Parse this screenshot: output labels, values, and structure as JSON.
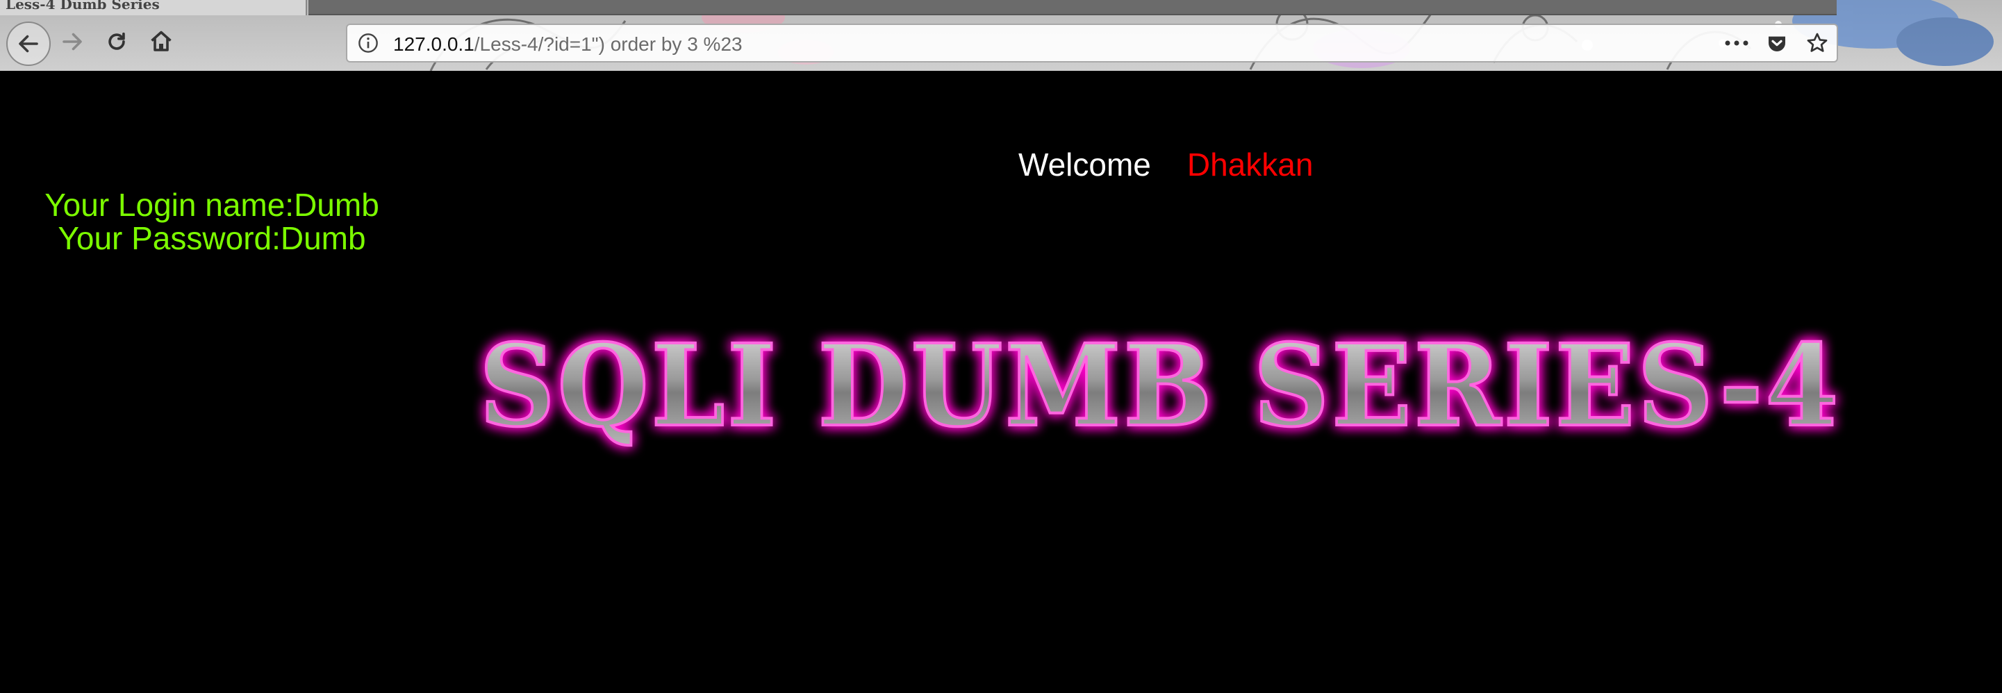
{
  "browser": {
    "tab_title": "Less-4 Dumb Series",
    "url_host": "127.0.0.1",
    "url_path": "/Less-4/?id=1\") order by 3 %23"
  },
  "page": {
    "welcome_label": "Welcome",
    "welcome_name": "Dhakkan",
    "login_line": "Your Login name:Dumb",
    "password_line": "Your Password:Dumb",
    "banner_text": "SQLI DUMB SERIES-4"
  },
  "colors": {
    "welcome": "#ffffff",
    "name": "#ff0000",
    "info": "#7cfc00",
    "banner_glow": "#ff00cc",
    "banner_fill": "#9a9a9a"
  }
}
